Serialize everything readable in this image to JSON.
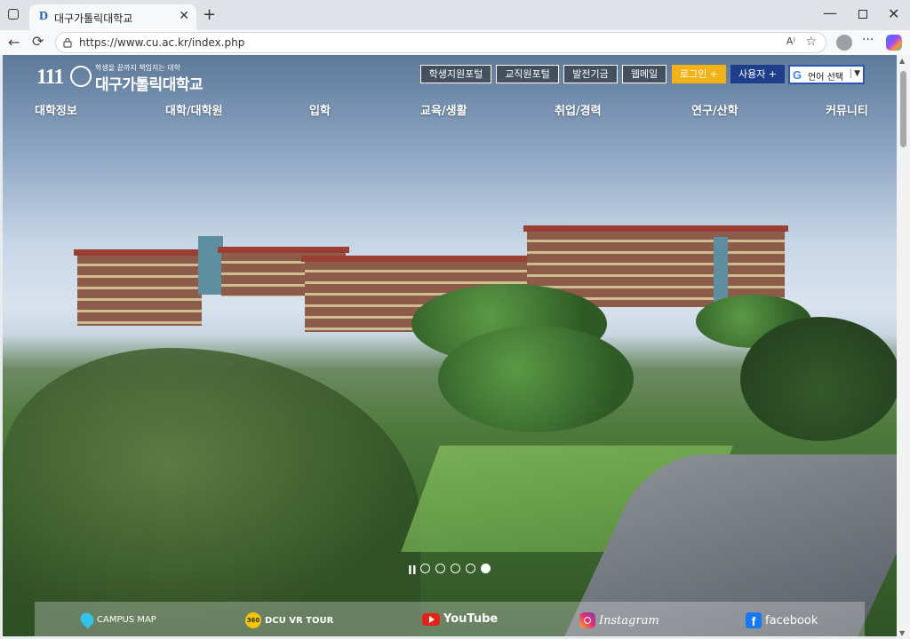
{
  "browser": {
    "tab_title": "대구가톨릭대학교",
    "favicon_letter": "D",
    "url": "https://www.cu.ac.kr/index.php",
    "tab_close": "✕",
    "new_tab": "+",
    "min": "—",
    "close": "✕",
    "back": "←",
    "reload": "⟳",
    "read_aloud": "A⁾",
    "favorite": "☆",
    "more": "···"
  },
  "header": {
    "logo_number": "111",
    "logo_slogan": "학생을 끝까지 책임지는 대학",
    "logo_name": "대구가톨릭대학교",
    "util_links": [
      "학생지원포털",
      "교직원포털",
      "발전기금",
      "웹메일"
    ],
    "login": "로그인 +",
    "user": "사용자 +",
    "language": "언어 선택",
    "language_caret": "▼",
    "google_letter": "G"
  },
  "gnb": [
    "대학정보",
    "대학/대학원",
    "입학",
    "교육/생활",
    "취업/경력",
    "연구/산학",
    "커뮤니티"
  ],
  "slider": {
    "pause": "II",
    "total": 5,
    "active_index": 5
  },
  "quick_links": [
    "CAMPUS MAP",
    "DCU VR TOUR",
    "YouTube",
    "Instagram",
    "facebook"
  ],
  "icon_360_text": "360",
  "scroll": {
    "up": "▲",
    "down": "▼"
  },
  "icons": [
    "window-icon",
    "favicon",
    "lock-icon",
    "read-aloud-icon",
    "star-icon",
    "profile-icon",
    "copilot-icon",
    "map-pin-icon",
    "vr-360-icon",
    "youtube-icon",
    "instagram-icon",
    "facebook-icon"
  ]
}
